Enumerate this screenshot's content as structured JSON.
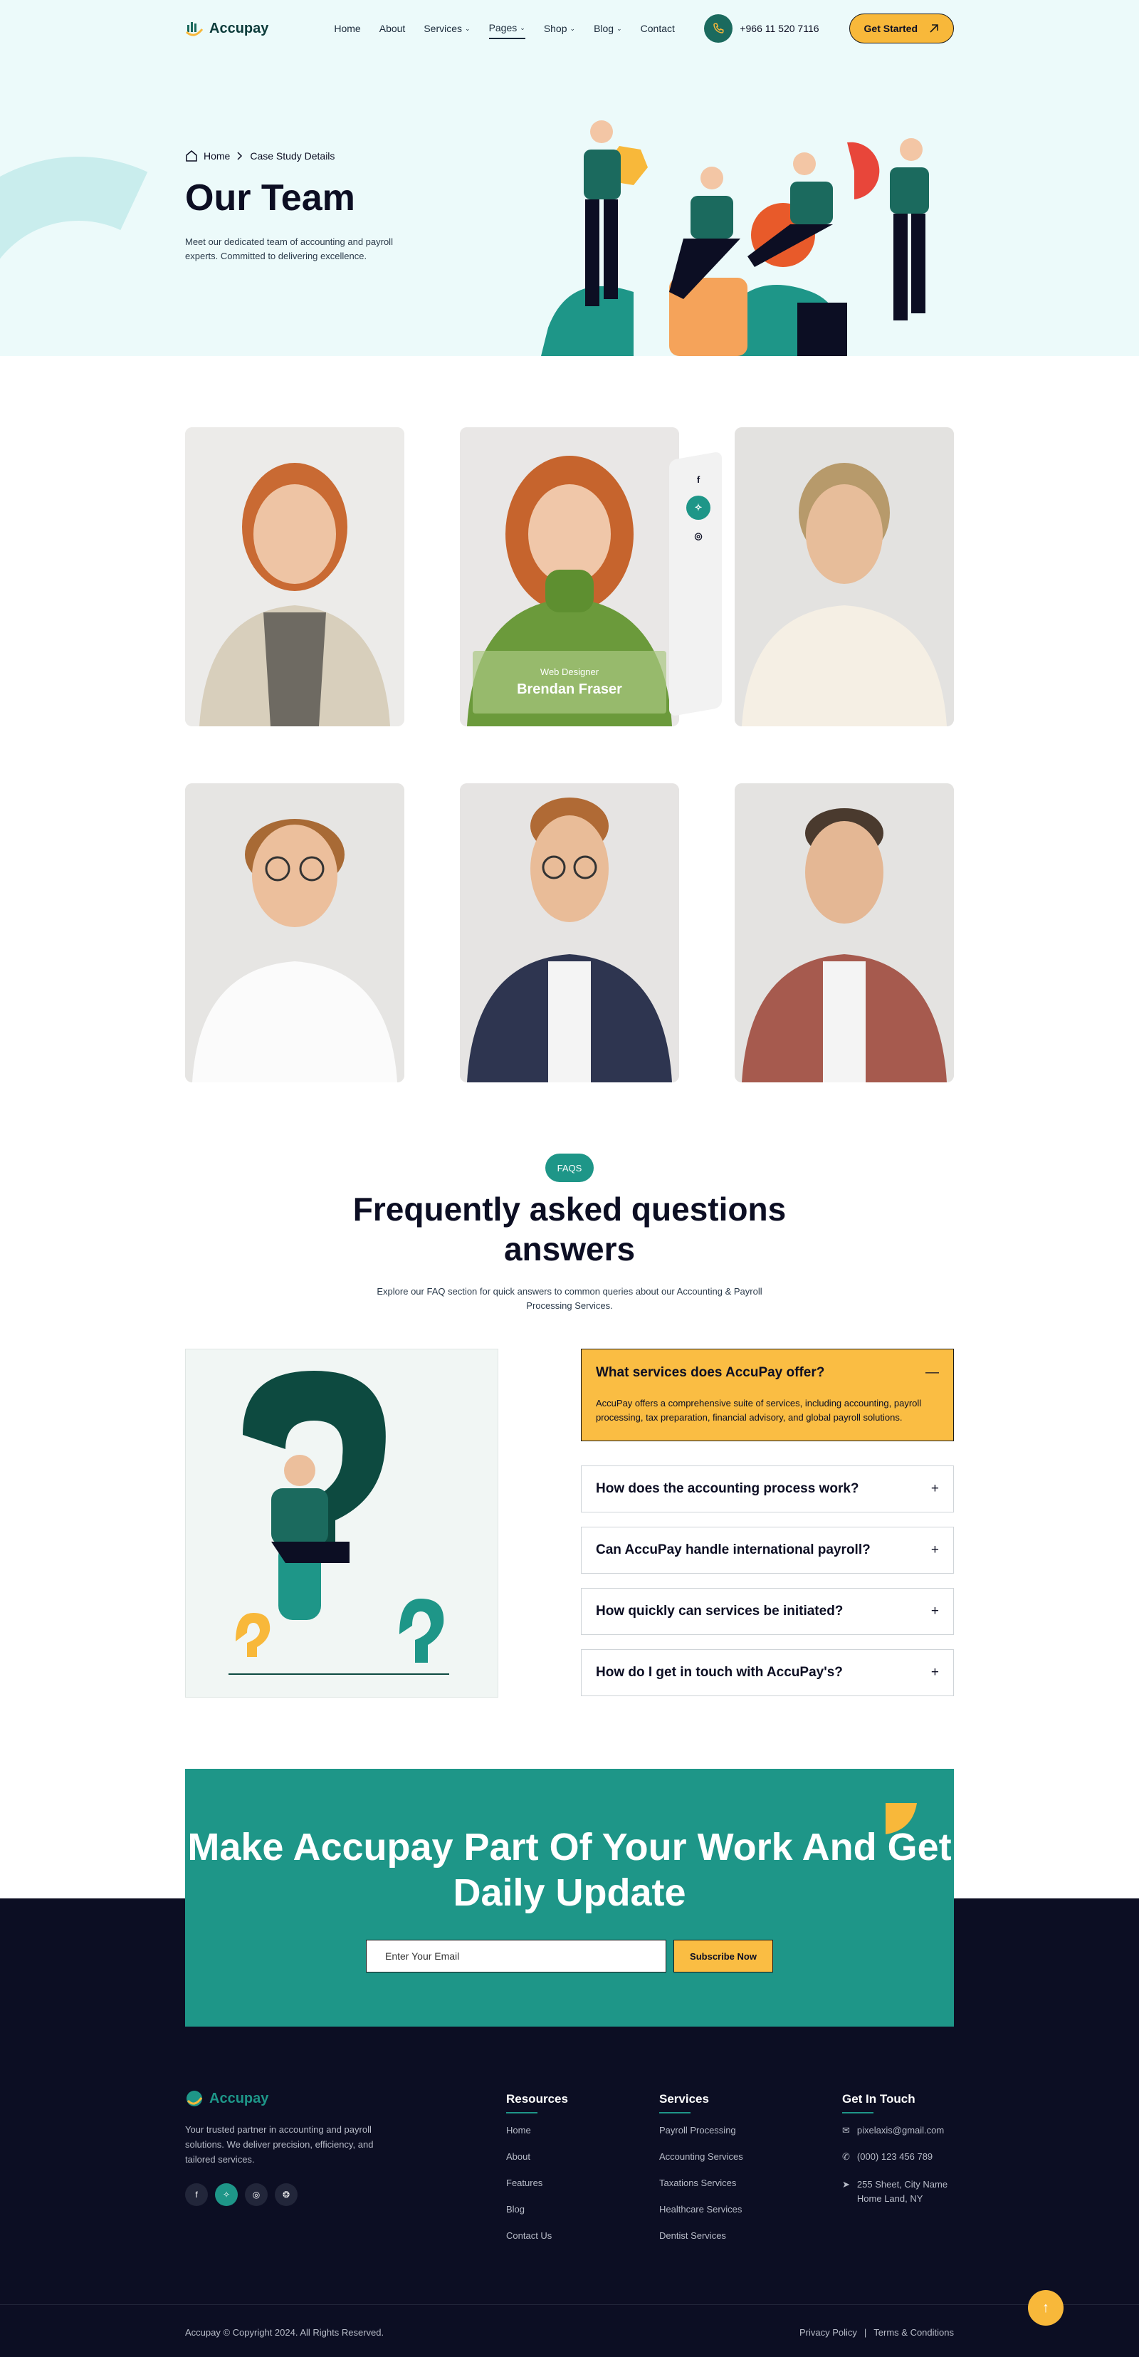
{
  "colors": {
    "teal": "#1e9688",
    "yellow": "#fabd43",
    "navy": "#0c0e23",
    "hero_bg": "#ecfafa"
  },
  "header": {
    "brand": "Accupay",
    "nav": [
      {
        "label": "Home"
      },
      {
        "label": "About"
      },
      {
        "label": "Services",
        "caret": true
      },
      {
        "label": "Pages",
        "caret": true,
        "active": true
      },
      {
        "label": "Shop",
        "caret": true
      },
      {
        "label": "Blog",
        "caret": true
      },
      {
        "label": "Contact"
      }
    ],
    "phone": "+966 11 520 7116",
    "cta": "Get Started"
  },
  "hero": {
    "breadcrumb": {
      "home": "Home",
      "current": "Case Study Details"
    },
    "title": "Our Team",
    "description": "Meet our dedicated team of accounting and payroll experts. Committed to delivering excellence."
  },
  "team": {
    "hover_card": {
      "role": "Web Designer",
      "name": "Brendan Fraser"
    },
    "social_icons": [
      "facebook-icon",
      "twitter-icon",
      "instagram-icon"
    ]
  },
  "faq": {
    "badge": "FAQS",
    "title": "Frequently asked questions answers",
    "subtitle": "Explore our FAQ section for quick answers to common queries about our Accounting & Payroll Processing Services.",
    "items": [
      {
        "q": "What services does AccuPay offer?",
        "a": "AccuPay offers a comprehensive suite of services, including accounting, payroll processing, tax preparation, financial advisory, and global payroll solutions.",
        "open": true
      },
      {
        "q": "How does the accounting process work?"
      },
      {
        "q": "Can AccuPay handle international payroll?"
      },
      {
        "q": "How quickly can services be initiated?"
      },
      {
        "q": "How do I get in touch with AccuPay's?"
      }
    ]
  },
  "newsletter": {
    "title": "Make Accupay Part Of Your Work And Get Daily Update",
    "placeholder": "Enter Your Email",
    "button": "Subscribe Now"
  },
  "footer": {
    "brand": "Accupay",
    "description": "Your trusted partner in accounting and payroll solutions. We deliver precision, efficiency, and tailored services.",
    "resources": {
      "title": "Resources",
      "links": [
        "Home",
        "About",
        "Features",
        "Blog",
        "Contact Us"
      ]
    },
    "services": {
      "title": "Services",
      "links": [
        "Payroll Processing",
        "Accounting Services",
        "Taxations Services",
        "Healthcare Services",
        "Dentist Services"
      ]
    },
    "contact": {
      "title": "Get In Touch",
      "email": "pixelaxis@gmail.com",
      "phone": "(000) 123 456 789",
      "address": "255 Sheet, City Name Home Land, NY"
    },
    "copyright": "Accupay © Copyright 2024. All Rights Reserved.",
    "privacy": "Privacy Policy",
    "separator": "|",
    "terms": "Terms & Conditions"
  }
}
